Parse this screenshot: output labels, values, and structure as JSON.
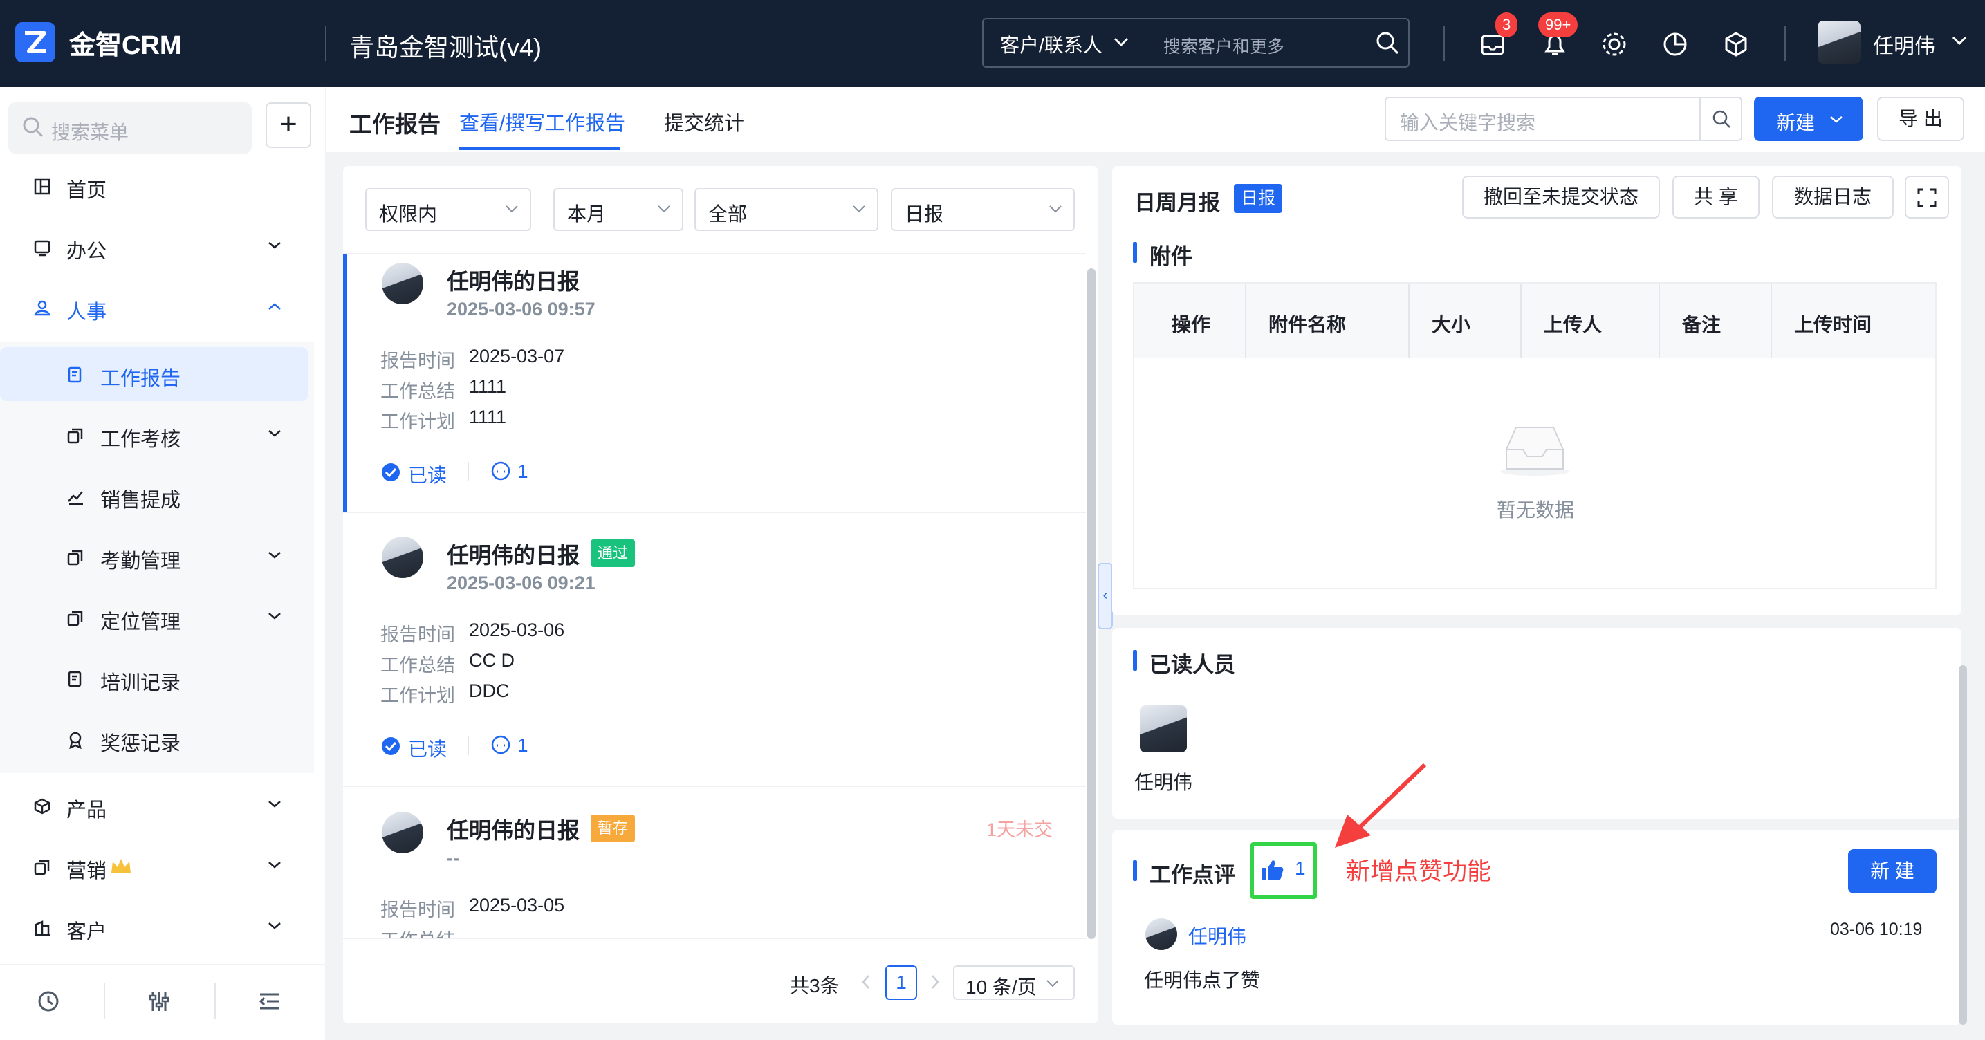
{
  "header": {
    "app_name": "金智CRM",
    "tenant": "青岛金智测试(v4)",
    "search_type": "客户/联系人",
    "search_placeholder": "搜索客户和更多",
    "badge_tasks": "3",
    "badge_notifications": "99+",
    "user_name": "任明伟"
  },
  "sidebar": {
    "search_placeholder": "搜索菜单",
    "items": [
      {
        "label": "首页"
      },
      {
        "label": "办公"
      },
      {
        "label": "人事"
      },
      {
        "label": "工作报告"
      },
      {
        "label": "工作考核"
      },
      {
        "label": "销售提成"
      },
      {
        "label": "考勤管理"
      },
      {
        "label": "定位管理"
      },
      {
        "label": "培训记录"
      },
      {
        "label": "奖惩记录"
      },
      {
        "label": "产品"
      },
      {
        "label": "营销"
      },
      {
        "label": "客户"
      }
    ]
  },
  "toolbar": {
    "page_title": "工作报告",
    "tabs": [
      {
        "label": "查看/撰写工作报告"
      },
      {
        "label": "提交统计"
      }
    ],
    "keyword_placeholder": "输入关键字搜索",
    "new_label": "新建",
    "export_label": "导 出"
  },
  "filters": [
    "权限内",
    "本月",
    "全部",
    "日报"
  ],
  "reports": [
    {
      "title": "任明伟的日报",
      "tag": "",
      "time": "2025-03-06 09:57",
      "report_date": "2025-03-07",
      "summary": "1111",
      "plan": "1111",
      "read_label": "已读",
      "comments": "1"
    },
    {
      "title": "任明伟的日报",
      "tag": "通过",
      "time": "2025-03-06 09:21",
      "report_date": "2025-03-06",
      "summary": "CC D",
      "plan": "DDC",
      "read_label": "已读",
      "comments": "1"
    },
    {
      "title": "任明伟的日报",
      "tag": "暂存",
      "time": "--",
      "report_date": "2025-03-05",
      "overdue": "1天未交"
    }
  ],
  "field_labels": {
    "report_time": "报告时间",
    "summary": "工作总结",
    "plan": "工作计划"
  },
  "pagination": {
    "total": "共3条",
    "page": "1",
    "page_size": "10 条/页"
  },
  "detail": {
    "title": "日周月报",
    "type_tag": "日报",
    "btn_revert": "撤回至未提交状态",
    "btn_share": "共 享",
    "btn_log": "数据日志",
    "attachments": {
      "title": "附件",
      "columns": [
        "操作",
        "附件名称",
        "大小",
        "上传人",
        "备注",
        "上传时间"
      ],
      "empty_text": "暂无数据"
    },
    "readers": {
      "title": "已读人员",
      "names": [
        "任明伟"
      ]
    },
    "comments": {
      "title": "工作点评",
      "like_count": "1",
      "new_label": "新 建",
      "items": [
        {
          "author": "任明伟",
          "time": "03-06 10:19",
          "text": "任明伟点了赞"
        }
      ]
    }
  },
  "annotation": {
    "text": "新增点赞功能"
  },
  "colors": {
    "primary": "#1f66f0",
    "header_bg": "#142033",
    "pass": "#19c37d",
    "draft": "#f7a93b",
    "alert": "#f53f3f",
    "highlight": "#34d448"
  }
}
